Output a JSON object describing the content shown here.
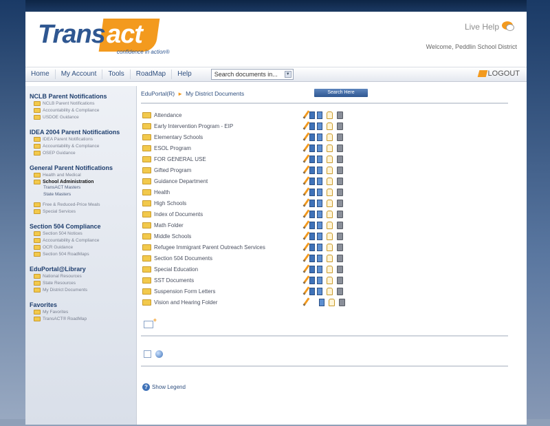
{
  "header": {
    "logo_trans": "Trans",
    "logo_act": "act",
    "tagline": "confidence in action®",
    "live_help": "Live Help",
    "welcome": "Welcome, Peddlin School District"
  },
  "nav": {
    "items": [
      "Home",
      "My Account",
      "Tools",
      "RoadMap",
      "Help"
    ],
    "search_select": "Search documents in...",
    "logout": "LOGOUT"
  },
  "sidebar": {
    "nclb": {
      "title": "NCLB Parent Notifications",
      "items": [
        "NCLB Parent Notifications",
        "Accountability & Compliance",
        "USDOE Guidance"
      ]
    },
    "idea": {
      "title": "IDEA 2004 Parent Notifications",
      "items": [
        "IDEA Parent Notifications",
        "Accountability & Compliance",
        "OSEP Guidance"
      ]
    },
    "general": {
      "title": "General Parent Notifications",
      "items": [
        "Health and Medical",
        "School Administration"
      ],
      "subitems": [
        "TransACT Masters",
        "State Masters"
      ],
      "items2": [
        "Free & Reduced-Price Meals",
        "Special Services"
      ]
    },
    "section504": {
      "title": "Section 504 Compliance",
      "items": [
        "Section 504 Notices",
        "Accountability & Compliance",
        "OCR Guidance",
        "Section 504 RoadMaps"
      ]
    },
    "library": {
      "title": "EduPortal@Library",
      "items": [
        "National Resources",
        "State Resources",
        "My District Documents"
      ]
    },
    "favorites": {
      "title": "Favorites",
      "items": [
        "My Favorites",
        "TransACT® RoadMap"
      ]
    }
  },
  "main": {
    "breadcrumb_root": "EduPortal(R)",
    "breadcrumb_current": "My District Documents",
    "search_button": "Search Here",
    "folders": [
      "Attendance",
      "Early Intervention Program - EIP",
      "Elementary Schools",
      "ESOL Program",
      "FOR GENERAL USE",
      "Gifted Program",
      "Guidance Department",
      "Health",
      "High Schools",
      "Index of Documents",
      "Math Folder",
      "Middle Schools",
      "Refugee Immigrant Parent Outreach Services",
      "Section 504 Documents",
      "Special Education",
      "SST Documents",
      "Suspension Form Letters",
      "Vision and Hearing Folder"
    ],
    "show_legend": "Show Legend"
  }
}
